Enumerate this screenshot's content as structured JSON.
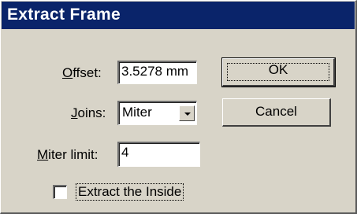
{
  "window": {
    "title": "Extract Frame"
  },
  "fields": {
    "offset": {
      "label_mnemonic": "O",
      "label_rest": "ffset:",
      "value": "3.5278 mm"
    },
    "joins": {
      "label_mnemonic": "J",
      "label_rest": "oins:",
      "value": "Miter"
    },
    "miter_limit": {
      "label_mnemonic": "M",
      "label_rest": "iter limit:",
      "value": "4"
    }
  },
  "checkbox": {
    "label": "Extract the Inside",
    "checked": false
  },
  "buttons": {
    "ok": "OK",
    "cancel": "Cancel"
  }
}
